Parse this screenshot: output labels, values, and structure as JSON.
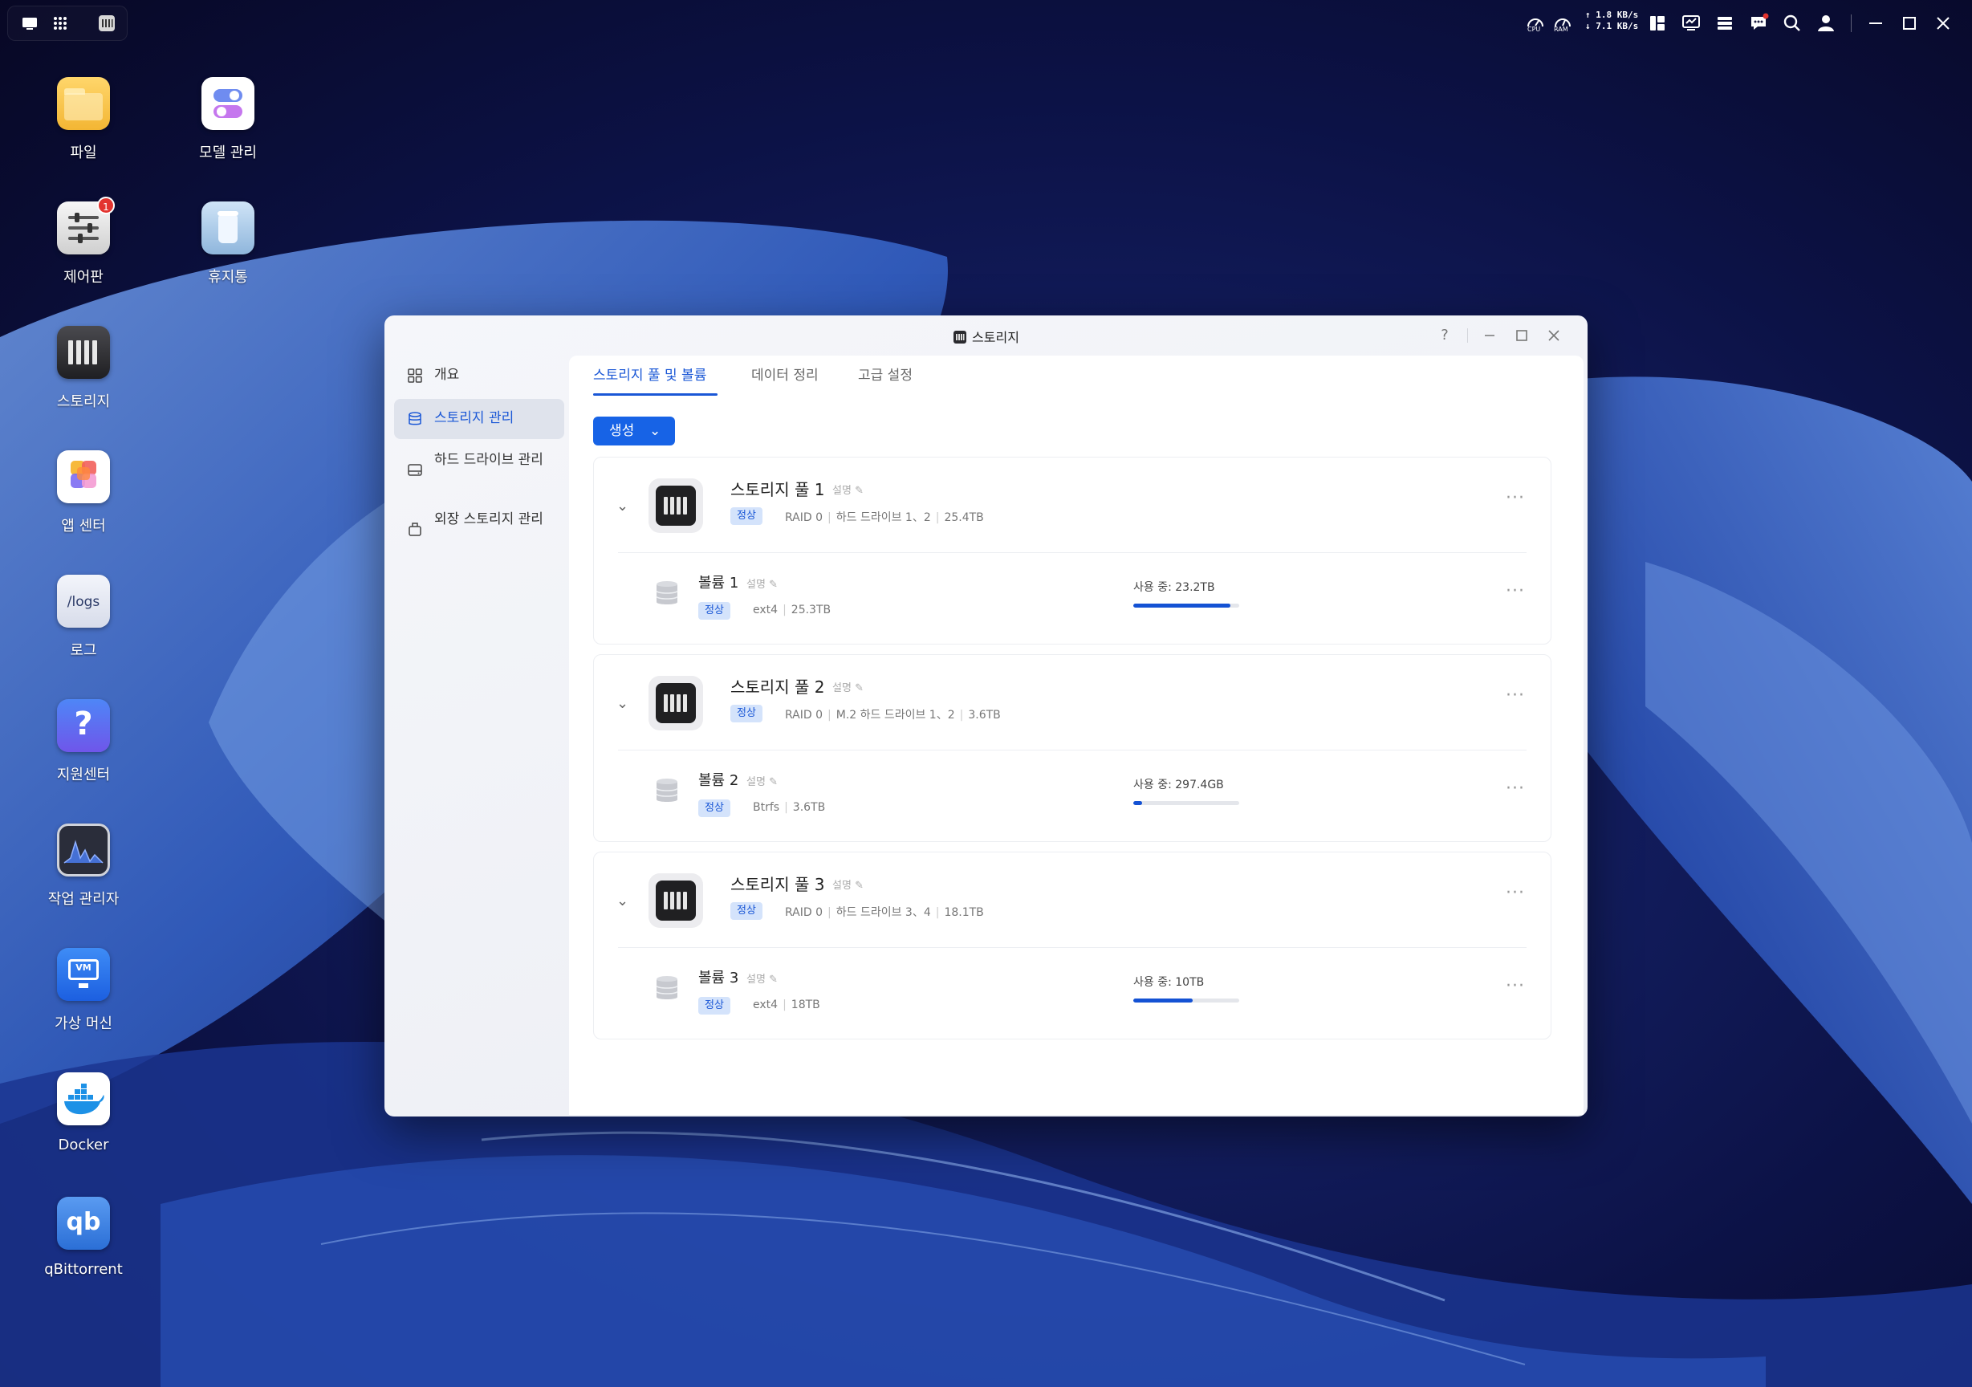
{
  "taskbar": {
    "network": {
      "up": "↑ 1.8 KB/s",
      "down": "↓ 7.1 KB/s"
    },
    "cpu_label": "CPU",
    "ram_label": "RAM"
  },
  "desktop": {
    "icons": [
      {
        "label": "파일",
        "icon": "folder-icon"
      },
      {
        "label": "모델 관리",
        "icon": "toggle-icon"
      },
      {
        "label": "제어판",
        "icon": "sliders-icon",
        "badge": "1"
      },
      {
        "label": "휴지통",
        "icon": "trash-icon"
      },
      {
        "label": "스토리지",
        "icon": "storage-icon"
      },
      {
        "label": "앱 센터",
        "icon": "app-center-icon"
      },
      {
        "label": "로그",
        "icon": "logs-icon",
        "icon_text": "/logs"
      },
      {
        "label": "지원센터",
        "icon": "help-icon",
        "icon_text": "?"
      },
      {
        "label": "작업 관리자",
        "icon": "monitor-chart-icon"
      },
      {
        "label": "가상 머신",
        "icon": "vm-icon",
        "icon_text": "VM"
      },
      {
        "label": "Docker",
        "icon": "docker-icon"
      },
      {
        "label": "qBittorrent",
        "icon": "qbittorrent-icon",
        "icon_text": "qb"
      }
    ]
  },
  "window": {
    "title": "스토리지",
    "help": "?",
    "sidebar": [
      {
        "label": "개요",
        "icon": "grid-icon"
      },
      {
        "label": "스토리지 관리",
        "icon": "database-icon",
        "active": true
      },
      {
        "label": "하드 드라이브 관리",
        "icon": "hard-drive-icon"
      },
      {
        "label": "외장 스토리지 관리",
        "icon": "external-drive-icon"
      }
    ],
    "tabs": [
      "스토리지 풀 및 볼륨",
      "데이터 정리",
      "고급 설정"
    ],
    "create_button": "생성",
    "desc_label": "설명",
    "pools": [
      {
        "name": "스토리지 풀 1",
        "status": "정상",
        "raid": "RAID 0",
        "drives": "하드 드라이브 1、2",
        "size": "25.4TB",
        "volume": {
          "name": "볼륨 1",
          "status": "정상",
          "fs": "ext4",
          "size": "25.3TB",
          "usage": "사용 중: 23.2TB",
          "usage_fraction": 0.92
        }
      },
      {
        "name": "스토리지 풀 2",
        "status": "정상",
        "raid": "RAID 0",
        "drives": "M.2 하드 드라이브 1、2",
        "size": "3.6TB",
        "volume": {
          "name": "볼륨 2",
          "status": "정상",
          "fs": "Btrfs",
          "size": "3.6TB",
          "usage": "사용 중: 297.4GB",
          "usage_fraction": 0.08
        }
      },
      {
        "name": "스토리지 풀 3",
        "status": "정상",
        "raid": "RAID 0",
        "drives": "하드 드라이브 3、4",
        "size": "18.1TB",
        "volume": {
          "name": "볼륨 3",
          "status": "정상",
          "fs": "ext4",
          "size": "18TB",
          "usage": "사용 중: 10TB",
          "usage_fraction": 0.56
        }
      }
    ]
  }
}
